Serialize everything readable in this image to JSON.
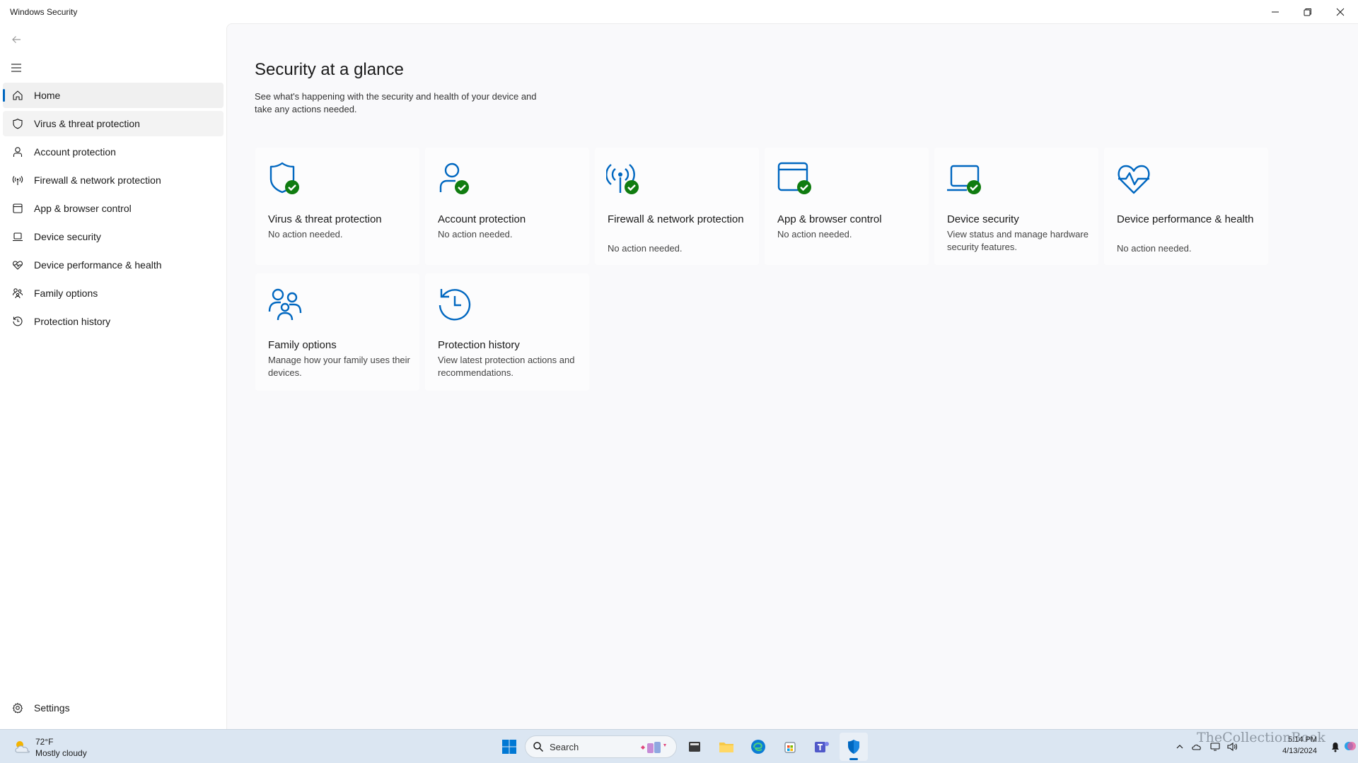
{
  "window": {
    "title": "Windows Security"
  },
  "sidebar": {
    "items": [
      {
        "label": "Home",
        "icon": "home-icon"
      },
      {
        "label": "Virus & threat protection",
        "icon": "shield-icon"
      },
      {
        "label": "Account protection",
        "icon": "person-icon"
      },
      {
        "label": "Firewall & network protection",
        "icon": "antenna-icon"
      },
      {
        "label": "App & browser control",
        "icon": "app-window-icon"
      },
      {
        "label": "Device security",
        "icon": "laptop-icon"
      },
      {
        "label": "Device performance & health",
        "icon": "heart-pulse-icon"
      },
      {
        "label": "Family options",
        "icon": "family-icon"
      },
      {
        "label": "Protection history",
        "icon": "history-icon"
      }
    ],
    "settings_label": "Settings"
  },
  "main": {
    "title": "Security at a glance",
    "description": "See what's happening with the security and health of your device and take any actions needed.",
    "tiles": [
      {
        "title": "Virus & threat protection",
        "status": "No action needed.",
        "icon": "shield-check-icon",
        "ok": true
      },
      {
        "title": "Account protection",
        "status": "No action needed.",
        "icon": "person-check-icon",
        "ok": true
      },
      {
        "title": "Firewall & network protection",
        "status": "No action needed.",
        "icon": "antenna-check-icon",
        "ok": true
      },
      {
        "title": "App & browser control",
        "status": "No action needed.",
        "icon": "app-window-check-icon",
        "ok": true
      },
      {
        "title": "Device security",
        "status": "View status and manage hardware security features.",
        "icon": "laptop-check-icon",
        "ok": true
      },
      {
        "title": "Device performance & health",
        "status": "No action needed.",
        "icon": "heart-pulse-icon",
        "ok": false
      },
      {
        "title": "Family options",
        "status": "Manage how your family uses their devices.",
        "icon": "family-icon",
        "ok": false
      },
      {
        "title": "Protection history",
        "status": "View latest protection actions and recommendations.",
        "icon": "history-icon",
        "ok": false
      }
    ]
  },
  "taskbar": {
    "weather_temp": "72°F",
    "weather_desc": "Mostly cloudy",
    "search_label": "Search",
    "time": "5:14 PM",
    "date": "4/13/2024",
    "watermark": "TheCollectionBook"
  },
  "colors": {
    "accent": "#0067c0",
    "success": "#107c10",
    "main_bg": "#f9f9fb",
    "taskbar_bg": "#dbe6f2"
  }
}
